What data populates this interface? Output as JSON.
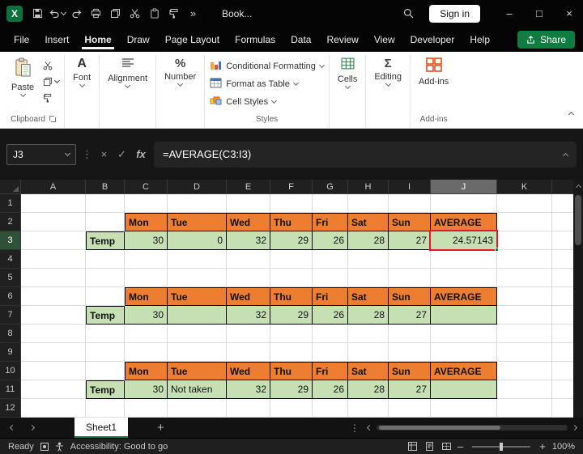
{
  "title_bar": {
    "workbook_name": "Book...",
    "sign_in": "Sign in"
  },
  "menu": {
    "tabs": [
      "File",
      "Insert",
      "Home",
      "Draw",
      "Page Layout",
      "Formulas",
      "Data",
      "Review",
      "View",
      "Developer",
      "Help"
    ],
    "active_tab": "Home",
    "share": "Share"
  },
  "ribbon": {
    "paste": "Paste",
    "clipboard_group": "Clipboard",
    "font": "Font",
    "alignment": "Alignment",
    "number": "Number",
    "conditional_formatting": "Conditional Formatting",
    "format_as_table": "Format as Table",
    "cell_styles": "Cell Styles",
    "styles_group": "Styles",
    "cells": "Cells",
    "editing": "Editing",
    "add_ins": "Add-ins",
    "add_ins_group": "Add-ins"
  },
  "formula_bar": {
    "name_box": "J3",
    "formula": "=AVERAGE(C3:I3)"
  },
  "grid": {
    "columns": [
      "A",
      "B",
      "C",
      "D",
      "E",
      "F",
      "G",
      "H",
      "I",
      "J",
      "K"
    ],
    "row_numbers": [
      "1",
      "2",
      "3",
      "4",
      "5",
      "6",
      "7",
      "8",
      "9",
      "10",
      "11",
      "12"
    ],
    "days": [
      "Mon",
      "Tue",
      "Wed",
      "Thu",
      "Fri",
      "Sat",
      "Sun"
    ],
    "average_header": "AVERAGE",
    "selected_cell": "J3",
    "selected_column": "J",
    "selected_row": "3",
    "tables": [
      {
        "label": "Temp",
        "values": [
          "30",
          "0",
          "32",
          "29",
          "26",
          "28",
          "27"
        ],
        "average": "24.57143"
      },
      {
        "label": "Temp",
        "values": [
          "30",
          "",
          "32",
          "29",
          "26",
          "28",
          "27"
        ],
        "average": ""
      },
      {
        "label": "Temp",
        "values": [
          "30",
          "Not taken",
          "32",
          "29",
          "26",
          "28",
          "27"
        ],
        "average": ""
      }
    ]
  },
  "sheet": {
    "name": "Sheet1"
  },
  "status": {
    "ready": "Ready",
    "accessibility": "Accessibility: Good to go",
    "zoom": "100%"
  },
  "colors": {
    "accent_green": "#107C41",
    "header_orange": "#ED7D31",
    "cell_green": "#C6E0B4",
    "highlight_red": "#E01B24"
  },
  "icons": {
    "excel_logo": "X",
    "overflow": "»",
    "ellipsis_v": "⋮",
    "minimize": "–",
    "maximize": "□",
    "close": "×",
    "cancel": "×",
    "enter": "✓",
    "fx": "fx",
    "font": "A",
    "percent": "%",
    "sigma": "Σ",
    "plus": "+",
    "zoom_out": "–",
    "zoom_in": "+"
  }
}
